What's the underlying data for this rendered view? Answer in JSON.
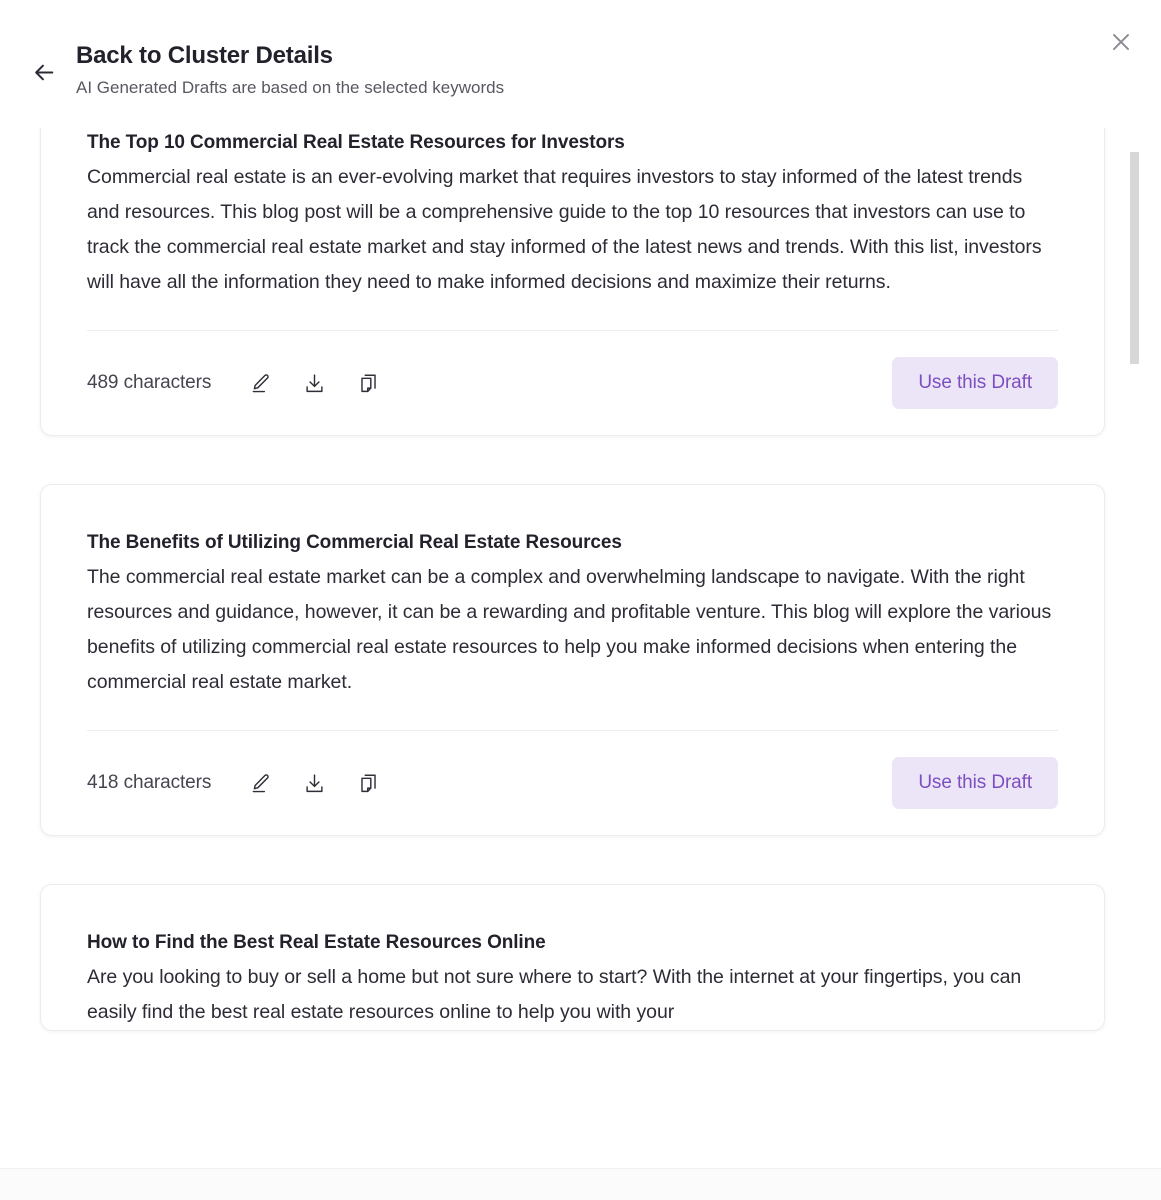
{
  "header": {
    "back_icon": "arrow-left-icon",
    "title": "Back to Cluster Details",
    "subtitle": "AI Generated Drafts are based on the selected keywords",
    "close_icon": "close-icon"
  },
  "colors": {
    "accent_text": "#7d4fc0",
    "accent_bg": "#ece4f7",
    "title_text": "#22222c",
    "body_text": "#2c2c36",
    "subtitle_text": "#585862",
    "card_border": "#ececed",
    "divider": "#ececee",
    "scrollbar_thumb": "#d7d7d9",
    "close_icon": "#8a8a92"
  },
  "actions": {
    "edit_icon": "pencil-icon",
    "download_icon": "download-icon",
    "copy_icon": "copy-icon",
    "use_draft_label": "Use this Draft"
  },
  "drafts": [
    {
      "title": "The Top 10 Commercial Real Estate Resources for Investors",
      "body": "Commercial real estate is an ever-evolving market that requires investors to stay informed of the latest trends and resources. This blog post will be a comprehensive guide to the top 10 resources that investors can use to track the commercial real estate market and stay informed of the latest news and trends. With this list, investors will have all the information they need to make informed decisions and maximize their returns.",
      "char_count": "489 characters"
    },
    {
      "title": "The Benefits of Utilizing Commercial Real Estate Resources",
      "body": "The commercial real estate market can be a complex and overwhelming landscape to navigate. With the right resources and guidance, however, it can be a rewarding and profitable venture. This blog will explore the various benefits of utilizing commercial real estate resources to help you make informed decisions when entering the commercial real estate market.",
      "char_count": "418 characters"
    },
    {
      "title": "How to Find the Best Real Estate Resources Online",
      "body": "Are you looking to buy or sell a home but not sure where to start? With the internet at your fingertips, you can easily find the best real estate resources online to help you with your",
      "char_count": ""
    }
  ]
}
